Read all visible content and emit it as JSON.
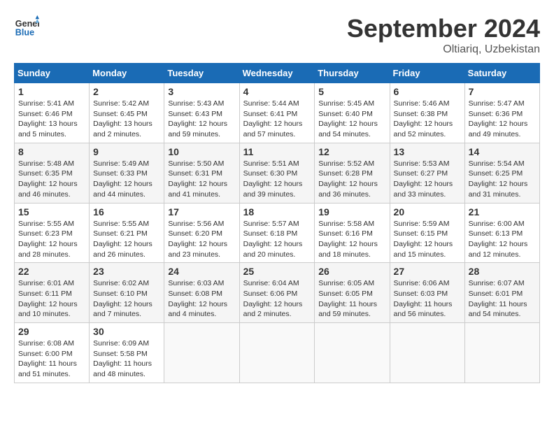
{
  "header": {
    "logo_text_general": "General",
    "logo_text_blue": "Blue",
    "month": "September 2024",
    "location": "Oltiariq, Uzbekistan"
  },
  "weekdays": [
    "Sunday",
    "Monday",
    "Tuesday",
    "Wednesday",
    "Thursday",
    "Friday",
    "Saturday"
  ],
  "weeks": [
    [
      {
        "day": "1",
        "sunrise": "5:41 AM",
        "sunset": "6:46 PM",
        "daylight": "13 hours and 5 minutes."
      },
      {
        "day": "2",
        "sunrise": "5:42 AM",
        "sunset": "6:45 PM",
        "daylight": "13 hours and 2 minutes."
      },
      {
        "day": "3",
        "sunrise": "5:43 AM",
        "sunset": "6:43 PM",
        "daylight": "12 hours and 59 minutes."
      },
      {
        "day": "4",
        "sunrise": "5:44 AM",
        "sunset": "6:41 PM",
        "daylight": "12 hours and 57 minutes."
      },
      {
        "day": "5",
        "sunrise": "5:45 AM",
        "sunset": "6:40 PM",
        "daylight": "12 hours and 54 minutes."
      },
      {
        "day": "6",
        "sunrise": "5:46 AM",
        "sunset": "6:38 PM",
        "daylight": "12 hours and 52 minutes."
      },
      {
        "day": "7",
        "sunrise": "5:47 AM",
        "sunset": "6:36 PM",
        "daylight": "12 hours and 49 minutes."
      }
    ],
    [
      {
        "day": "8",
        "sunrise": "5:48 AM",
        "sunset": "6:35 PM",
        "daylight": "12 hours and 46 minutes."
      },
      {
        "day": "9",
        "sunrise": "5:49 AM",
        "sunset": "6:33 PM",
        "daylight": "12 hours and 44 minutes."
      },
      {
        "day": "10",
        "sunrise": "5:50 AM",
        "sunset": "6:31 PM",
        "daylight": "12 hours and 41 minutes."
      },
      {
        "day": "11",
        "sunrise": "5:51 AM",
        "sunset": "6:30 PM",
        "daylight": "12 hours and 39 minutes."
      },
      {
        "day": "12",
        "sunrise": "5:52 AM",
        "sunset": "6:28 PM",
        "daylight": "12 hours and 36 minutes."
      },
      {
        "day": "13",
        "sunrise": "5:53 AM",
        "sunset": "6:27 PM",
        "daylight": "12 hours and 33 minutes."
      },
      {
        "day": "14",
        "sunrise": "5:54 AM",
        "sunset": "6:25 PM",
        "daylight": "12 hours and 31 minutes."
      }
    ],
    [
      {
        "day": "15",
        "sunrise": "5:55 AM",
        "sunset": "6:23 PM",
        "daylight": "12 hours and 28 minutes."
      },
      {
        "day": "16",
        "sunrise": "5:55 AM",
        "sunset": "6:21 PM",
        "daylight": "12 hours and 26 minutes."
      },
      {
        "day": "17",
        "sunrise": "5:56 AM",
        "sunset": "6:20 PM",
        "daylight": "12 hours and 23 minutes."
      },
      {
        "day": "18",
        "sunrise": "5:57 AM",
        "sunset": "6:18 PM",
        "daylight": "12 hours and 20 minutes."
      },
      {
        "day": "19",
        "sunrise": "5:58 AM",
        "sunset": "6:16 PM",
        "daylight": "12 hours and 18 minutes."
      },
      {
        "day": "20",
        "sunrise": "5:59 AM",
        "sunset": "6:15 PM",
        "daylight": "12 hours and 15 minutes."
      },
      {
        "day": "21",
        "sunrise": "6:00 AM",
        "sunset": "6:13 PM",
        "daylight": "12 hours and 12 minutes."
      }
    ],
    [
      {
        "day": "22",
        "sunrise": "6:01 AM",
        "sunset": "6:11 PM",
        "daylight": "12 hours and 10 minutes."
      },
      {
        "day": "23",
        "sunrise": "6:02 AM",
        "sunset": "6:10 PM",
        "daylight": "12 hours and 7 minutes."
      },
      {
        "day": "24",
        "sunrise": "6:03 AM",
        "sunset": "6:08 PM",
        "daylight": "12 hours and 4 minutes."
      },
      {
        "day": "25",
        "sunrise": "6:04 AM",
        "sunset": "6:06 PM",
        "daylight": "12 hours and 2 minutes."
      },
      {
        "day": "26",
        "sunrise": "6:05 AM",
        "sunset": "6:05 PM",
        "daylight": "11 hours and 59 minutes."
      },
      {
        "day": "27",
        "sunrise": "6:06 AM",
        "sunset": "6:03 PM",
        "daylight": "11 hours and 56 minutes."
      },
      {
        "day": "28",
        "sunrise": "6:07 AM",
        "sunset": "6:01 PM",
        "daylight": "11 hours and 54 minutes."
      }
    ],
    [
      {
        "day": "29",
        "sunrise": "6:08 AM",
        "sunset": "6:00 PM",
        "daylight": "11 hours and 51 minutes."
      },
      {
        "day": "30",
        "sunrise": "6:09 AM",
        "sunset": "5:58 PM",
        "daylight": "11 hours and 48 minutes."
      },
      null,
      null,
      null,
      null,
      null
    ]
  ]
}
